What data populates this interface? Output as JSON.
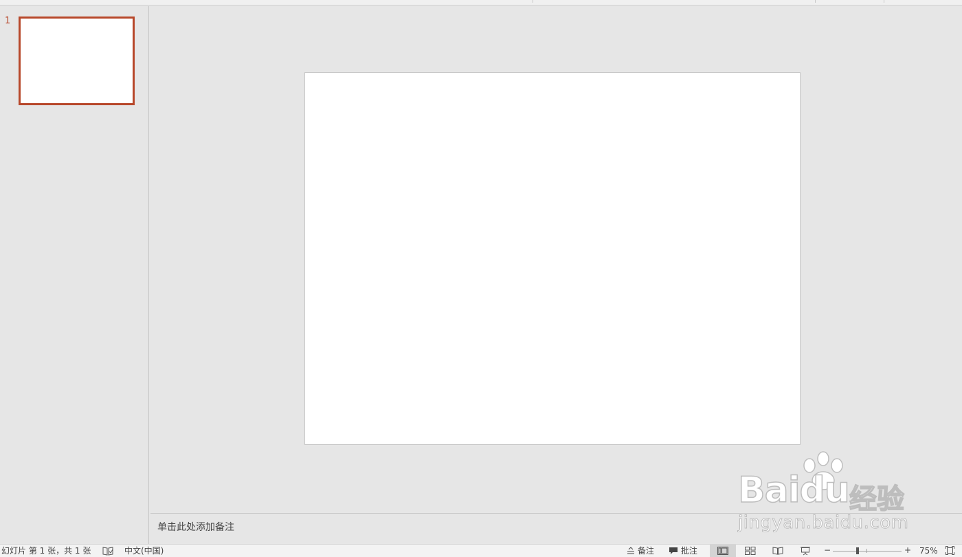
{
  "thumbnails": [
    {
      "number": "1"
    }
  ],
  "notes": {
    "placeholder": "单击此处添加备注"
  },
  "status_bar": {
    "slide_info": "幻灯片 第 1 张，共 1 张",
    "language": "中文(中国)",
    "notes_label": "备注",
    "comments_label": "批注",
    "zoom_out": "−",
    "zoom_in": "+",
    "zoom_level": "75%",
    "zoom_percent": 75
  },
  "watermark": {
    "logo": "Baidu",
    "chinese": "经验",
    "url": "jingyan.baidu.com"
  },
  "colors": {
    "accent": "#b7472a",
    "background": "#e6e6e6",
    "slide": "#ffffff"
  }
}
